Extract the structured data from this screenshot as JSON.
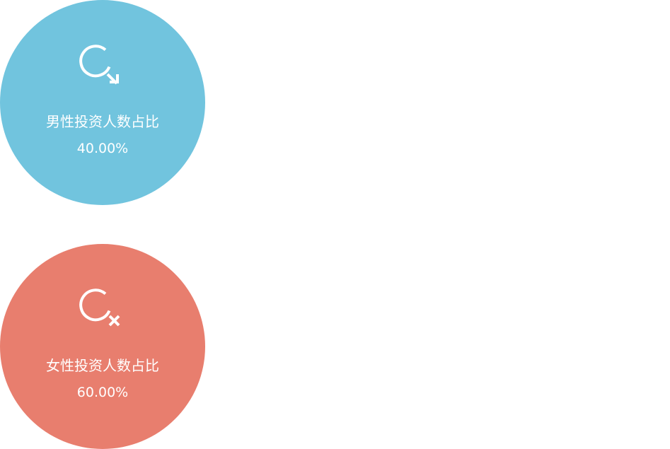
{
  "stats": [
    {
      "label": "男性投资人数占比",
      "value": "40.00%",
      "color": "#71C4DE",
      "icon": "male-symbol-icon"
    },
    {
      "label": "女性投资人数占比",
      "value": "60.00%",
      "color": "#E87E6E",
      "icon": "female-symbol-icon"
    }
  ]
}
